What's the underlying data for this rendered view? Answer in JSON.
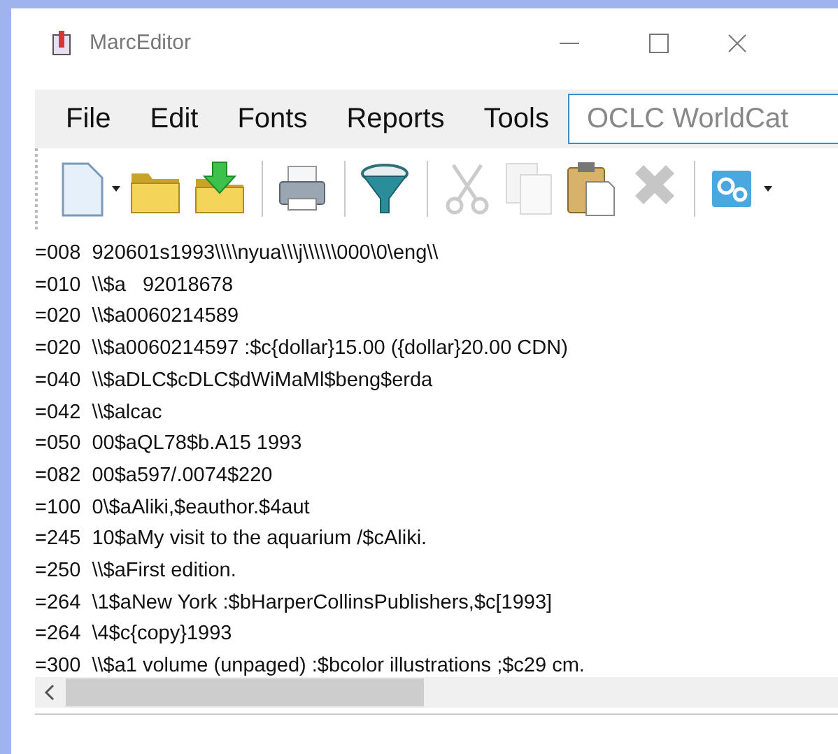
{
  "window": {
    "title": "MarcEditor"
  },
  "menu": [
    "File",
    "Edit",
    "Fonts",
    "Reports",
    "Tools"
  ],
  "search": {
    "placeholder": "OCLC WorldCat"
  },
  "toolbar": [
    {
      "kind": "new",
      "disabled": false
    },
    {
      "kind": "dropdown",
      "disabled": false
    },
    {
      "kind": "open",
      "disabled": false
    },
    {
      "kind": "import",
      "disabled": false
    },
    {
      "kind": "separator",
      "disabled": false
    },
    {
      "kind": "print",
      "disabled": false
    },
    {
      "kind": "separator",
      "disabled": false
    },
    {
      "kind": "filter",
      "disabled": false
    },
    {
      "kind": "separator",
      "disabled": false
    },
    {
      "kind": "cut",
      "disabled": true
    },
    {
      "kind": "copy",
      "disabled": true
    },
    {
      "kind": "paste",
      "disabled": false
    },
    {
      "kind": "delete",
      "disabled": true
    },
    {
      "kind": "separator",
      "disabled": false
    },
    {
      "kind": "tools",
      "disabled": false
    },
    {
      "kind": "dropdown",
      "disabled": false
    }
  ],
  "lines": [
    "=008  920601s1993\\\\\\\\nyua\\\\\\j\\\\\\\\\\\\000\\0\\eng\\\\",
    "=010  \\\\$a   92018678",
    "=020  \\\\$a0060214589",
    "=020  \\\\$a0060214597 :$c{dollar}15.00 ({dollar}20.00 CDN)",
    "=040  \\\\$aDLC$cDLC$dWiMaMl$beng$erda",
    "=042  \\\\$alcac",
    "=050  00$aQL78$b.A15 1993",
    "=082  00$a597/.0074$220",
    "=100  0\\$aAliki,$eauthor.$4aut",
    "=245  10$aMy visit to the aquarium /$cAliki.",
    "=250  \\\\$aFirst edition.",
    "=264  \\1$aNew York :$bHarperCollinsPublishers,$c[1993]",
    "=264  \\4$c{copy}1993",
    "=300  \\\\$a1 volume (unpaged) :$bcolor illustrations ;$c29 cm."
  ]
}
